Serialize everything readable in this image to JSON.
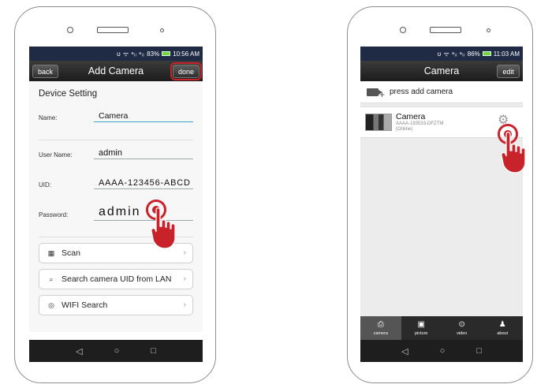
{
  "colors": {
    "accent_red": "#c8222a",
    "status_bar": "#1f2a44",
    "input_underline_active": "#3da0c9"
  },
  "left_phone": {
    "status": {
      "signal": "ʊ ᯤ ᵃᵢᵢ ᵃᵢᵢ",
      "battery_percent": "83%",
      "time": "10:56 AM"
    },
    "header": {
      "back_label": "back",
      "title": "Add Camera",
      "done_label": "done"
    },
    "form": {
      "section_title": "Device Setting",
      "fields": [
        {
          "label": "Name:",
          "value": "Camera"
        },
        {
          "label": "User Name:",
          "value": "admin"
        },
        {
          "label": "UID:",
          "value": "AAAA-123456-ABCD"
        },
        {
          "label": "Password:",
          "value": "admin"
        }
      ]
    },
    "actions": [
      {
        "icon": "qr-code-icon",
        "glyph": "▦",
        "label": "Scan"
      },
      {
        "icon": "search-icon",
        "glyph": "⌕",
        "label": "Search camera UID from LAN"
      },
      {
        "icon": "wifi-icon",
        "glyph": "◎",
        "label": "WIFI Search"
      }
    ],
    "chevron": "›",
    "nav": {
      "back": "◁",
      "home": "○",
      "recent": "□"
    }
  },
  "right_phone": {
    "status": {
      "signal": "ʊ ᯤ ᵃᵢᵢ ᵃᵢᵢ",
      "battery_percent": "86%",
      "time": "11:03 AM"
    },
    "header": {
      "title": "Camera",
      "edit_label": "edit"
    },
    "add_camera_label": "press add camera",
    "camera": {
      "name": "Camera",
      "uid": "AAAA-193533-DFZTM",
      "status": "(Online)"
    },
    "tabs": [
      {
        "icon": "camera-icon",
        "glyph": "⎙",
        "label": "camera"
      },
      {
        "icon": "picture-icon",
        "glyph": "▣",
        "label": "picture"
      },
      {
        "icon": "video-icon",
        "glyph": "⊙",
        "label": "video"
      },
      {
        "icon": "person-icon",
        "glyph": "♟",
        "label": "about"
      }
    ],
    "nav": {
      "back": "◁",
      "home": "○",
      "recent": "□"
    }
  }
}
